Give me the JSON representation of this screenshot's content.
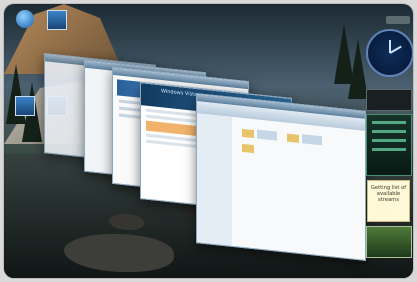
{
  "desktop": {
    "icons": [
      {
        "name": "recycle-bin-icon"
      },
      {
        "name": "computer-icon"
      }
    ]
  },
  "windows": {
    "front_header_text": "Windows Vista"
  },
  "sidebar": {
    "feed_gadget_text": "Getting list of available streams"
  }
}
